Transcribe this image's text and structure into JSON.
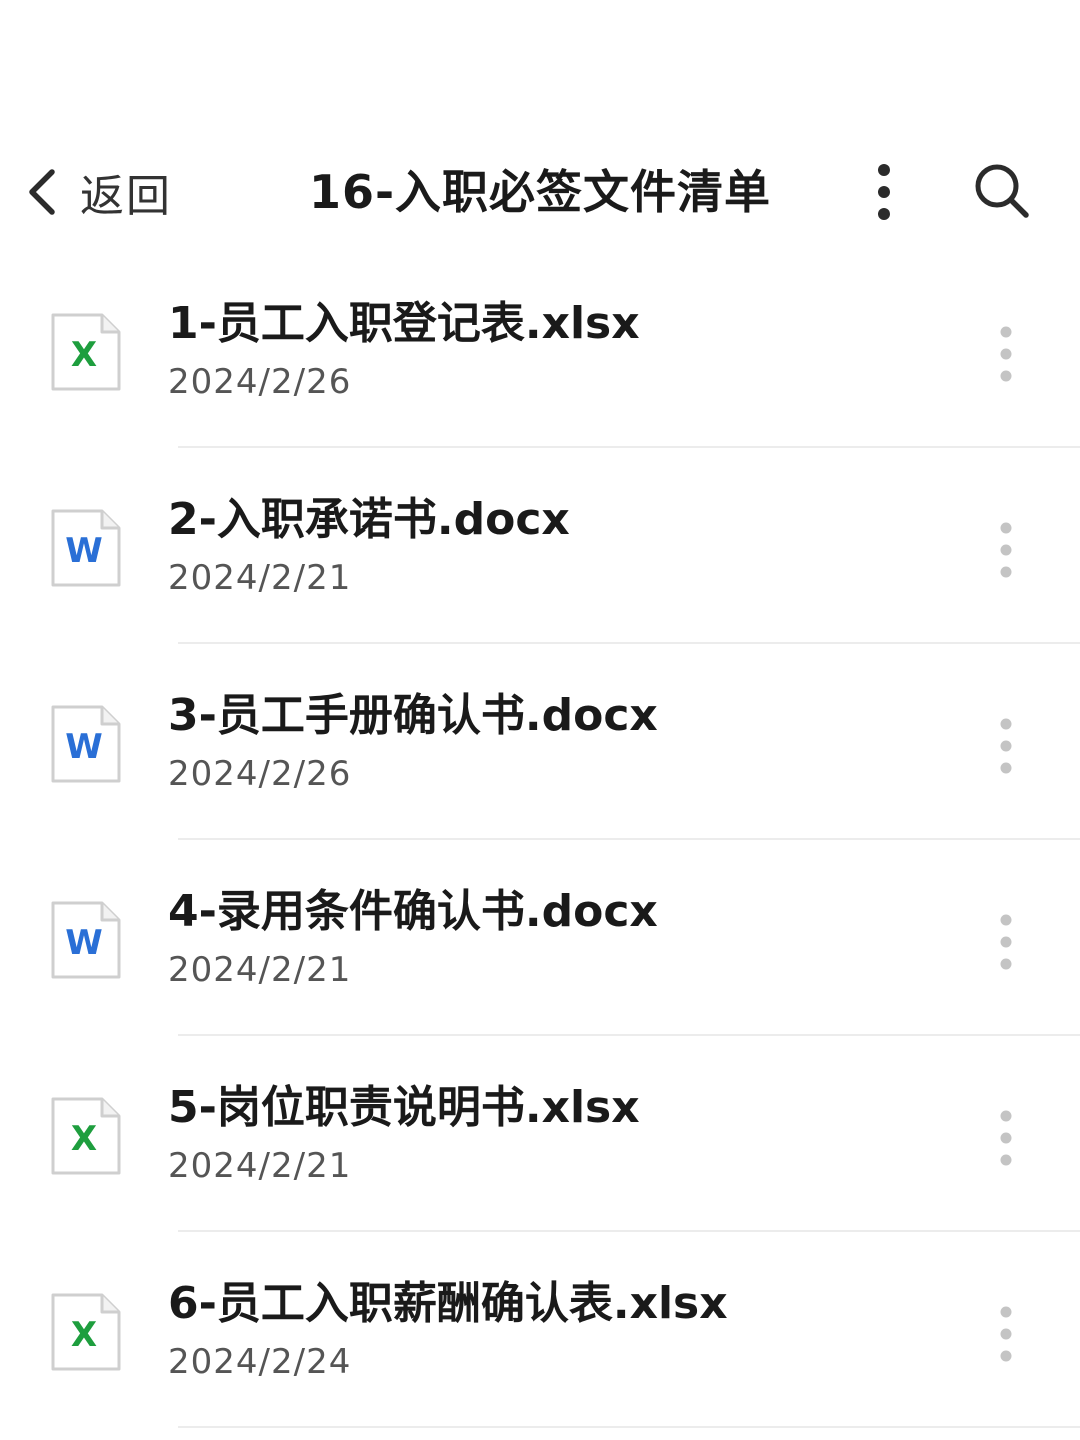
{
  "header": {
    "back_label": "返回",
    "title": "16-入职必签文件清单",
    "more_icon": "more-vertical-icon",
    "search_icon": "search-icon"
  },
  "colors": {
    "excel": "#1e9e3e",
    "word": "#2a6fd6",
    "divider": "#ececec"
  },
  "files": [
    {
      "name": "1-员工入职登记表.xlsx",
      "date": "2024/2/26",
      "type": "excel",
      "badge": "X"
    },
    {
      "name": "2-入职承诺书.docx",
      "date": "2024/2/21",
      "type": "word",
      "badge": "W"
    },
    {
      "name": "3-员工手册确认书.docx",
      "date": "2024/2/26",
      "type": "word",
      "badge": "W"
    },
    {
      "name": "4-录用条件确认书.docx",
      "date": "2024/2/21",
      "type": "word",
      "badge": "W"
    },
    {
      "name": "5-岗位职责说明书.xlsx",
      "date": "2024/2/21",
      "type": "excel",
      "badge": "X"
    },
    {
      "name": "6-员工入职薪酬确认表.xlsx",
      "date": "2024/2/24",
      "type": "excel",
      "badge": "X"
    }
  ]
}
